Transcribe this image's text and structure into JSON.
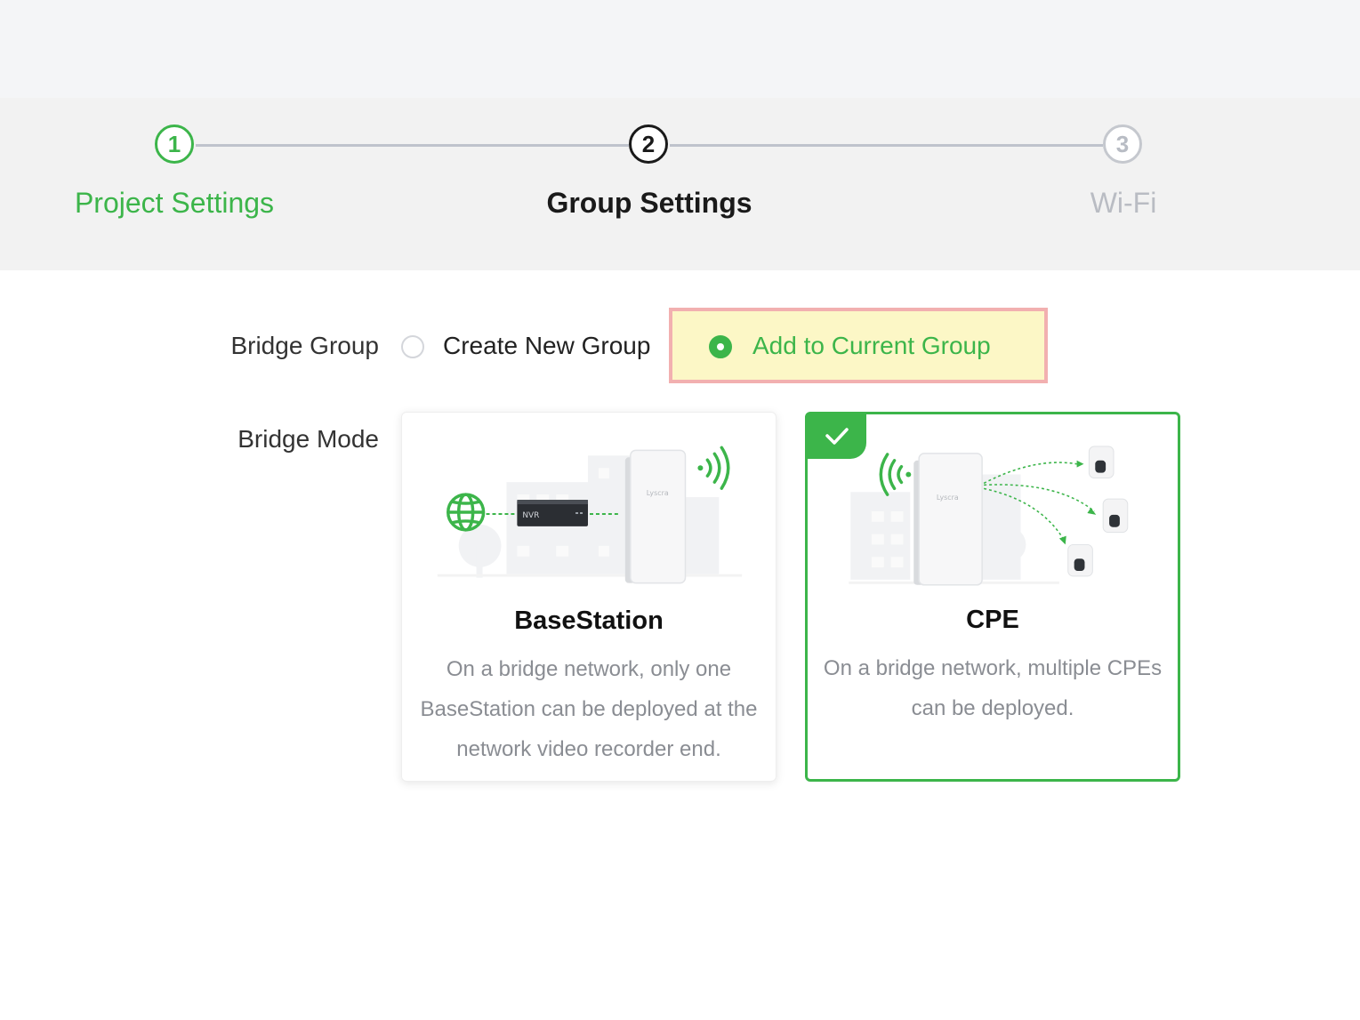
{
  "steps": [
    {
      "number": "1",
      "label": "Project Settings",
      "state": "completed"
    },
    {
      "number": "2",
      "label": "Group Settings",
      "state": "active"
    },
    {
      "number": "3",
      "label": "Wi-Fi",
      "state": "pending"
    }
  ],
  "bridge_group": {
    "label": "Bridge Group",
    "options": [
      {
        "label": "Create New Group",
        "selected": false
      },
      {
        "label": "Add to Current Group",
        "selected": true
      }
    ]
  },
  "bridge_mode": {
    "label": "Bridge Mode",
    "cards": [
      {
        "title": "BaseStation",
        "description": "On a bridge network, only one BaseStation can be deployed at the network video recorder end.",
        "nvr_label": "NVR",
        "device_brand": "Lyscra",
        "selected": false
      },
      {
        "title": "CPE",
        "description": "On a bridge network, multiple CPEs can be deployed.",
        "device_brand": "Lyscra",
        "selected": true
      }
    ]
  },
  "colors": {
    "accent": "#3cb54a",
    "highlight_fill": "#fcf7c6",
    "highlight_border": "#f2b0b0"
  }
}
